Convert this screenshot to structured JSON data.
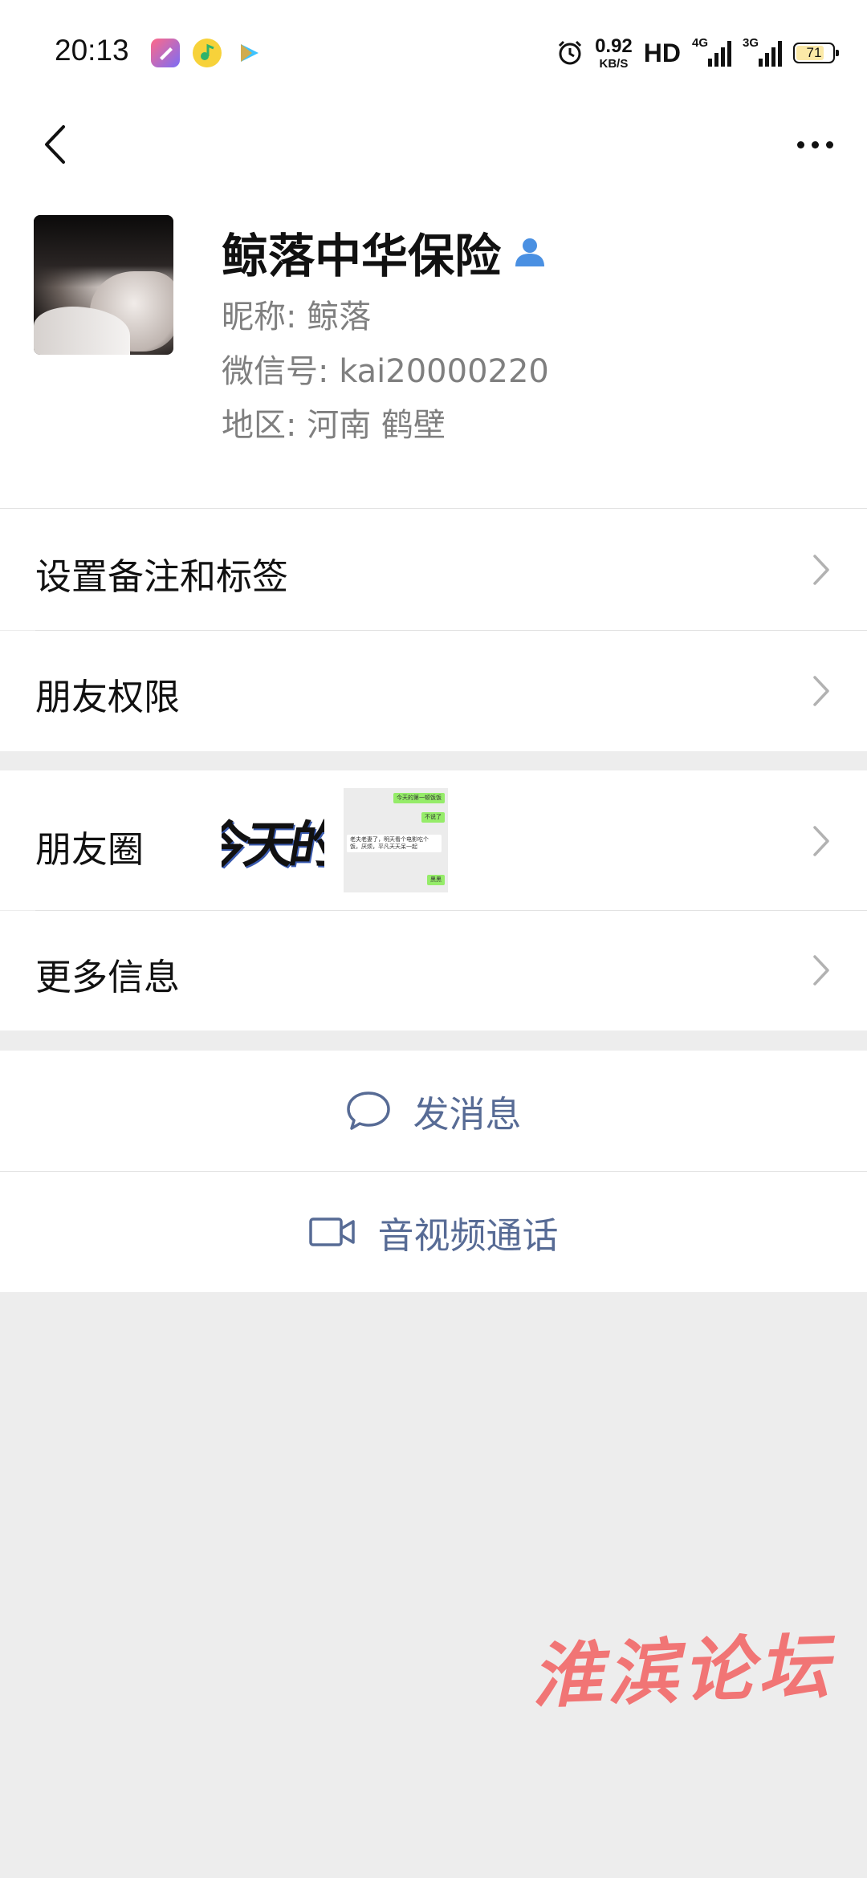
{
  "status_bar": {
    "time": "20:13",
    "net_speed_value": "0.92",
    "net_speed_unit": "KB/S",
    "hd_label": "HD",
    "sim1_label": "4G",
    "sim2_label": "3G",
    "battery": "71",
    "app_icons": [
      "screen-recorder-app-icon",
      "qq-music-app-icon",
      "video-app-icon"
    ]
  },
  "profile": {
    "name": "鲸落中华保险",
    "nickname_line": "昵称: 鲸落",
    "wechat_id_line": "微信号: kai20000220",
    "region_line": "地区: 河南  鹤壁"
  },
  "cells": {
    "remark_tags": "设置备注和标签",
    "permissions": "朋友权限",
    "moments": "朋友圈",
    "more_info": "更多信息"
  },
  "moments_preview": {
    "thumb1_text": "今天的",
    "chat_lines": [
      "今天的第一顿饭饭",
      "不说了",
      "老夫老妻了，明天看个电影吃个饭，厌烦，平凡天天呆一起",
      "黑黑"
    ]
  },
  "actions": {
    "send_message": "发消息",
    "av_call": "音视频通话"
  },
  "watermark": "淮滨论坛",
  "colors": {
    "link": "#576b95",
    "background": "#ededed",
    "chevron": "#b2b2b2",
    "watermark": "#f26f6f",
    "badge_blue": "#4a90e2"
  }
}
